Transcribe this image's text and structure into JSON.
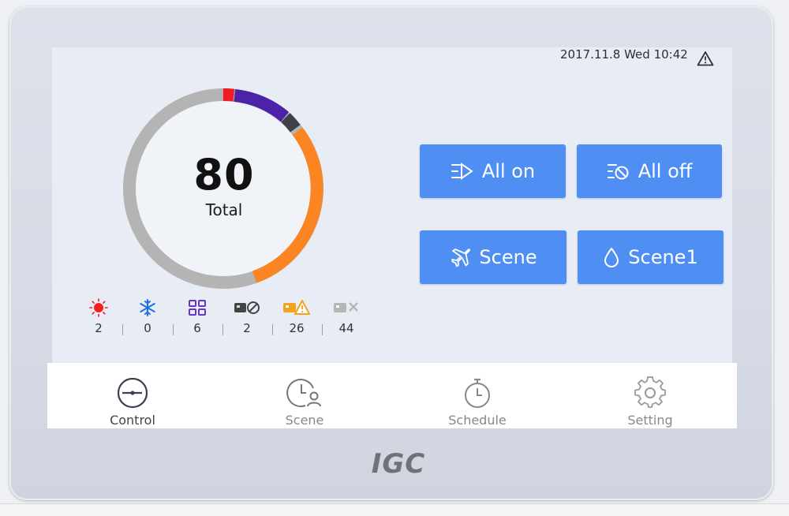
{
  "status_bar": {
    "datetime": "2017.11.8 Wed 10:42",
    "alert_icon": "warning-triangle-icon"
  },
  "summary": {
    "total_value": "80",
    "total_label": "Total",
    "ring_segments": [
      {
        "name": "heating",
        "color": "#ee1c25",
        "value": 2
      },
      {
        "name": "cooling",
        "color": "#4b22a8",
        "value": 0
      },
      {
        "name": "mode",
        "color": "#4b22a8",
        "value": 6
      },
      {
        "name": "disabled",
        "color": "#3d4047",
        "value": 2
      },
      {
        "name": "warning",
        "color": "#fb8523",
        "value": 26
      },
      {
        "name": "offline",
        "color": "#b0b0b0",
        "value": 44
      }
    ]
  },
  "stats": [
    {
      "icon": "sun-icon",
      "color": "#f0201e",
      "value": "2"
    },
    {
      "icon": "snowflake-icon",
      "color": "#1f6fe0",
      "value": "0"
    },
    {
      "icon": "grid-icon",
      "color": "#6b33c8",
      "value": "6"
    },
    {
      "icon": "device-disabled-icon",
      "color": "#444444",
      "value": "2"
    },
    {
      "icon": "device-warning-icon",
      "color": "#f2a21c",
      "value": "26"
    },
    {
      "icon": "device-offline-icon",
      "color": "#b5b5b5",
      "value": "44"
    }
  ],
  "actions": {
    "all_on": {
      "label": "All on",
      "icon": "all-on-icon"
    },
    "all_off": {
      "label": "All off",
      "icon": "all-off-icon"
    },
    "scene": {
      "label": "Scene",
      "icon": "airplane-icon"
    },
    "scene1": {
      "label": "Scene1",
      "icon": "droplet-icon"
    }
  },
  "nav": [
    {
      "label": "Control",
      "icon": "control-dial-icon",
      "active": true
    },
    {
      "label": "Scene",
      "icon": "clock-user-icon",
      "active": false
    },
    {
      "label": "Schedule",
      "icon": "stopwatch-icon",
      "active": false
    },
    {
      "label": "Setting",
      "icon": "gear-icon",
      "active": false
    }
  ],
  "brand": "IGC"
}
